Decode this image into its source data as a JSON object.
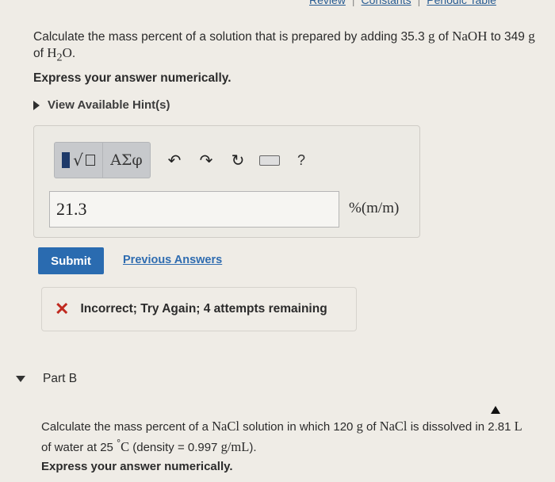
{
  "topbar": {
    "review": "Review",
    "constants": "Constants",
    "periodic": "Periodic Table",
    "sep": "|"
  },
  "partA": {
    "q_pre": "Calculate the mass percent of a solution that is prepared by adding 35.3",
    "q_unit_g1": "g",
    "q_of": "of",
    "q_naoh": "NaOH",
    "q_to": "to 349",
    "q_unit_g2": "g",
    "q_of2": "of",
    "q_h2o_h": "H",
    "q_h2o_sub": "2",
    "q_h2o_o": "O",
    "q_end": ".",
    "express": "Express your answer numerically.",
    "hint": "View Available Hint(s)"
  },
  "toolbar": {
    "greek": "ΑΣφ",
    "undo": "↶",
    "redo": "↷",
    "reset": "↻",
    "help": "?"
  },
  "answer": {
    "value": "21.3",
    "units": "%(m/m)"
  },
  "submit": "Submit",
  "previous": "Previous Answers",
  "feedback": {
    "icon": "✕",
    "text": "Incorrect; Try Again; 4 attempts remaining"
  },
  "partB": {
    "title": "Part B",
    "q_pre": "Calculate the mass percent of a",
    "q_nacl1": "NaCl",
    "q_mid": "solution in which 120",
    "q_g": "g",
    "q_of": "of",
    "q_nacl2": "NaCl",
    "q_mid2": "is dissolved in 2.81",
    "q_L": "L",
    "q_line2a": "of water at 25",
    "q_deg": "°",
    "q_C": "C",
    "q_dens": "(density = 0.997",
    "q_gml": "g/mL",
    "q_end": ").",
    "express": "Express your answer numerically."
  }
}
